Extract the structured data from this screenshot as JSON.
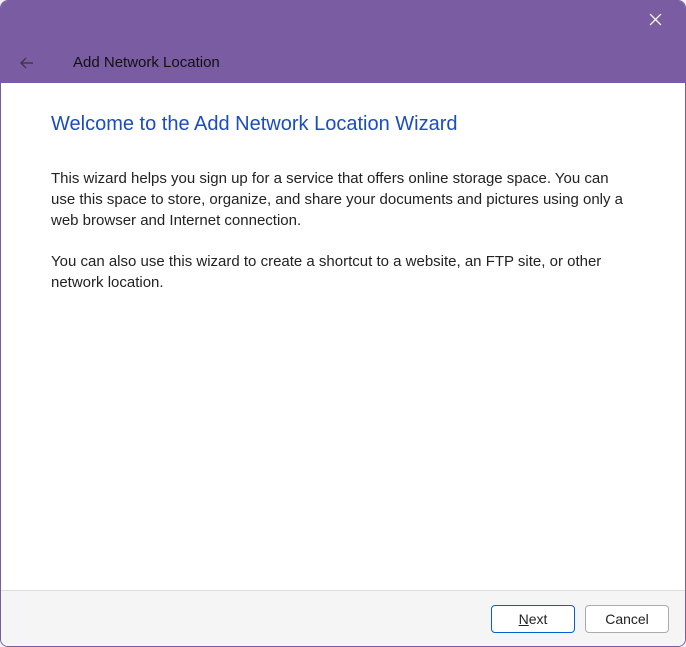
{
  "titlebar": {
    "title": "Add Network Location"
  },
  "content": {
    "heading": "Welcome to the Add Network Location Wizard",
    "p1": "This wizard helps you sign up for a service that offers online storage space.  You can use this space to store, organize, and share your documents and pictures using only a web browser and Internet connection.",
    "p2": "You can also use this wizard to create a shortcut to a website, an FTP site, or other network location."
  },
  "footer": {
    "next_prefix": "N",
    "next_rest": "ext",
    "cancel": "Cancel"
  }
}
